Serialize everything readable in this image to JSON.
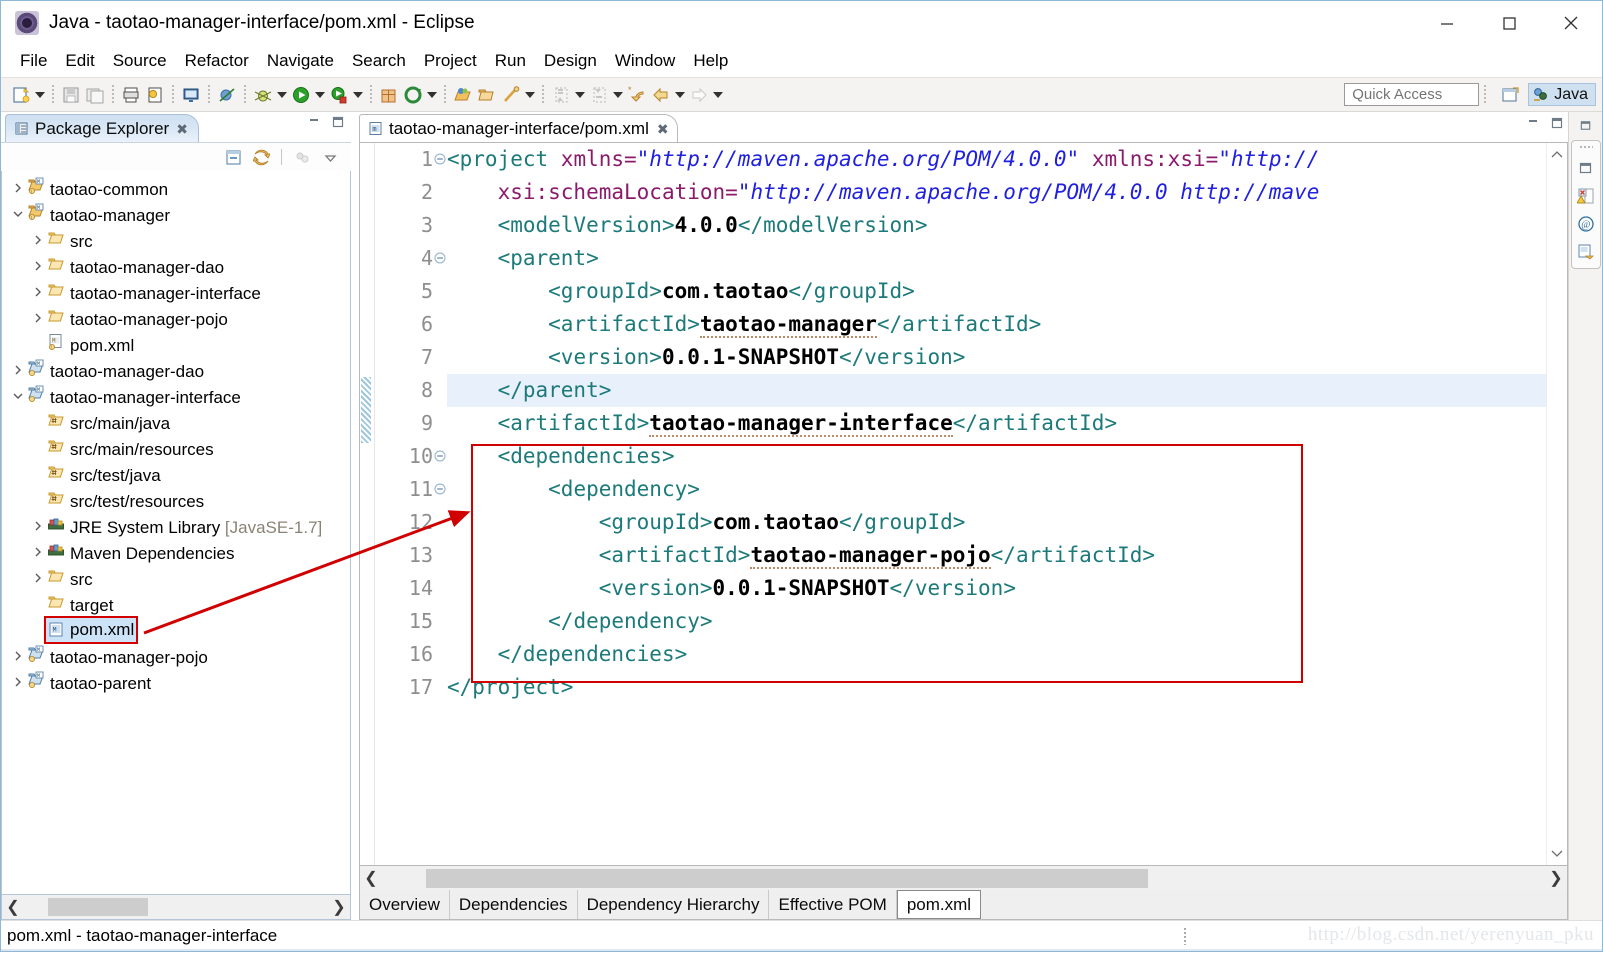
{
  "window": {
    "title": "Java - taotao-manager-interface/pom.xml - Eclipse",
    "app_icon": "eclipse-icon",
    "controls": {
      "minimize": "minimize-icon",
      "maximize": "maximize-icon",
      "close": "close-icon"
    }
  },
  "menubar": {
    "items": [
      "File",
      "Edit",
      "Source",
      "Refactor",
      "Navigate",
      "Search",
      "Project",
      "Run",
      "Design",
      "Window",
      "Help"
    ]
  },
  "toolbar": {
    "quick_access_placeholder": "Quick Access",
    "perspective_button": "open-perspective-icon",
    "perspective_current": "Java",
    "icons": [
      "new-wizard-icon",
      "dropdown-arrow",
      "save-icon",
      "save-all-icon",
      "print-icon",
      "annotation-icon",
      "open-console-icon",
      "skip-breakpoints-icon",
      "debug-icon",
      "dropdown-arrow",
      "run-icon",
      "dropdown-arrow",
      "run-last-tool-icon",
      "dropdown-arrow",
      "new-java-package-icon",
      "new-java-class-icon",
      "dropdown-arrow",
      "open-type-icon",
      "open-task-icon",
      "search-icon",
      "dropdown-arrow",
      "next-annotation-icon",
      "dropdown-arrow",
      "previous-annotation-icon",
      "dropdown-arrow",
      "last-edit-location-icon",
      "back-icon",
      "dropdown-arrow",
      "forward-icon",
      "dropdown-arrow"
    ]
  },
  "package_explorer": {
    "tab_label": "Package Explorer",
    "tab_icon": "package-explorer-icon",
    "close_icon": "close-tab-icon",
    "minimize_icon": "minimize-view-icon",
    "maximize_icon": "maximize-view-icon",
    "view_toolbar": [
      "collapse-all-icon",
      "link-with-editor-icon",
      "view-menu-icon",
      "view-chevron-icon"
    ],
    "tree": [
      {
        "label": "taotao-common",
        "indent": 0,
        "twisty": "collapsed",
        "icon": "maven-project-icon"
      },
      {
        "label": "taotao-manager",
        "indent": 0,
        "twisty": "expanded",
        "icon": "maven-project-icon"
      },
      {
        "label": "src",
        "indent": 1,
        "twisty": "collapsed",
        "icon": "folder-icon"
      },
      {
        "label": "taotao-manager-dao",
        "indent": 1,
        "twisty": "collapsed",
        "icon": "folder-icon"
      },
      {
        "label": "taotao-manager-interface",
        "indent": 1,
        "twisty": "collapsed",
        "icon": "folder-icon"
      },
      {
        "label": "taotao-manager-pojo",
        "indent": 1,
        "twisty": "collapsed",
        "icon": "folder-icon"
      },
      {
        "label": "pom.xml",
        "indent": 1,
        "twisty": "none",
        "icon": "maven-pom-icon"
      },
      {
        "label": "taotao-manager-dao",
        "indent": 0,
        "twisty": "collapsed",
        "icon": "java-project-icon"
      },
      {
        "label": "taotao-manager-interface",
        "indent": 0,
        "twisty": "expanded",
        "icon": "java-project-icon"
      },
      {
        "label": "src/main/java",
        "indent": 1,
        "twisty": "none",
        "icon": "source-folder-icon"
      },
      {
        "label": "src/main/resources",
        "indent": 1,
        "twisty": "none",
        "icon": "source-folder-icon"
      },
      {
        "label": "src/test/java",
        "indent": 1,
        "twisty": "none",
        "icon": "source-folder-icon"
      },
      {
        "label": "src/test/resources",
        "indent": 1,
        "twisty": "none",
        "icon": "source-folder-icon"
      },
      {
        "label": "JRE System Library",
        "suffix": "[JavaSE-1.7]",
        "indent": 1,
        "twisty": "collapsed",
        "icon": "library-icon"
      },
      {
        "label": "Maven Dependencies",
        "indent": 1,
        "twisty": "collapsed",
        "icon": "library-icon"
      },
      {
        "label": "src",
        "indent": 1,
        "twisty": "collapsed",
        "icon": "folder-icon"
      },
      {
        "label": "target",
        "indent": 1,
        "twisty": "none",
        "icon": "folder-icon"
      },
      {
        "label": "pom.xml",
        "indent": 1,
        "twisty": "none",
        "icon": "xml-file-icon",
        "selected": true,
        "highlighted": true
      },
      {
        "label": "taotao-manager-pojo",
        "indent": 0,
        "twisty": "collapsed",
        "icon": "java-project-icon"
      },
      {
        "label": "taotao-parent",
        "indent": 0,
        "twisty": "collapsed",
        "icon": "java-project-icon"
      }
    ],
    "hscroll": {
      "left_arrow": "scroll-left-icon",
      "right_arrow": "scroll-right-icon"
    }
  },
  "editor": {
    "tab_label": "taotao-manager-interface/pom.xml",
    "tab_icon": "maven-pom-icon",
    "close_icon": "close-tab-icon",
    "minimize_icon": "minimize-editor-icon",
    "maximize_icon": "maximize-editor-icon",
    "scroll_up_icon": "scroll-up-icon",
    "scroll_down_icon": "scroll-down-icon",
    "lines": [
      {
        "n": 1,
        "fold": "collapse",
        "indent": 0,
        "parts": [
          {
            "t": "tag",
            "v": "<project "
          },
          {
            "t": "attr",
            "v": "xmlns="
          },
          {
            "t": "str",
            "v": "\"http://maven.apache.org/POM/4.0.0\""
          },
          {
            "t": "plain",
            "v": " "
          },
          {
            "t": "attr",
            "v": "xmlns:xsi="
          },
          {
            "t": "str",
            "v": "\"http://"
          }
        ]
      },
      {
        "n": 2,
        "fold": "none",
        "indent": 1,
        "parts": [
          {
            "t": "attr",
            "v": "xsi:schemaLocation="
          },
          {
            "t": "str",
            "v": "\"http://maven.apache.org/POM/4.0.0 http://mave"
          }
        ]
      },
      {
        "n": 3,
        "fold": "none",
        "indent": 1,
        "parts": [
          {
            "t": "tag",
            "v": "<modelVersion>"
          },
          {
            "t": "txt",
            "v": "4.0.0"
          },
          {
            "t": "tag",
            "v": "</modelVersion>"
          }
        ]
      },
      {
        "n": 4,
        "fold": "collapse",
        "indent": 1,
        "parts": [
          {
            "t": "tag",
            "v": "<parent>"
          }
        ]
      },
      {
        "n": 5,
        "fold": "none",
        "indent": 2,
        "parts": [
          {
            "t": "tag",
            "v": "<groupId>"
          },
          {
            "t": "txt",
            "v": "com.taotao"
          },
          {
            "t": "tag",
            "v": "</groupId>"
          }
        ]
      },
      {
        "n": 6,
        "fold": "none",
        "indent": 2,
        "parts": [
          {
            "t": "tag",
            "v": "<artifactId>"
          },
          {
            "t": "txt sq",
            "v": "taotao-manager"
          },
          {
            "t": "tag",
            "v": "</artifactId>"
          }
        ]
      },
      {
        "n": 7,
        "fold": "none",
        "indent": 2,
        "parts": [
          {
            "t": "tag",
            "v": "<version>"
          },
          {
            "t": "txt",
            "v": "0.0.1-SNAPSHOT"
          },
          {
            "t": "tag",
            "v": "</version>"
          }
        ]
      },
      {
        "n": 8,
        "fold": "none",
        "indent": 1,
        "highlight": true,
        "parts": [
          {
            "t": "tag",
            "v": "</parent>"
          }
        ]
      },
      {
        "n": 9,
        "fold": "none",
        "indent": 1,
        "parts": [
          {
            "t": "tag",
            "v": "<artifactId>"
          },
          {
            "t": "txt sq",
            "v": "taotao-manager-interface"
          },
          {
            "t": "tag",
            "v": "</artifactId>"
          }
        ]
      },
      {
        "n": 10,
        "fold": "collapse",
        "indent": 1,
        "parts": [
          {
            "t": "tag",
            "v": "<dependencies>"
          }
        ]
      },
      {
        "n": 11,
        "fold": "collapse",
        "indent": 2,
        "parts": [
          {
            "t": "tag",
            "v": "<dependency>"
          }
        ]
      },
      {
        "n": 12,
        "fold": "none",
        "indent": 3,
        "parts": [
          {
            "t": "tag",
            "v": "<groupId>"
          },
          {
            "t": "txt",
            "v": "com.taotao"
          },
          {
            "t": "tag",
            "v": "</groupId>"
          }
        ]
      },
      {
        "n": 13,
        "fold": "none",
        "indent": 3,
        "parts": [
          {
            "t": "tag",
            "v": "<artifactId>"
          },
          {
            "t": "txt sq",
            "v": "taotao-manager-pojo"
          },
          {
            "t": "tag",
            "v": "</artifactId>"
          }
        ]
      },
      {
        "n": 14,
        "fold": "none",
        "indent": 3,
        "parts": [
          {
            "t": "tag",
            "v": "<version>"
          },
          {
            "t": "txt",
            "v": "0.0.1-SNAPSHOT"
          },
          {
            "t": "tag",
            "v": "</version>"
          }
        ]
      },
      {
        "n": 15,
        "fold": "none",
        "indent": 2,
        "parts": [
          {
            "t": "tag",
            "v": "</dependency>"
          }
        ]
      },
      {
        "n": 16,
        "fold": "none",
        "indent": 1,
        "parts": [
          {
            "t": "tag",
            "v": "</dependencies>"
          }
        ]
      },
      {
        "n": 17,
        "fold": "none",
        "indent": 0,
        "parts": [
          {
            "t": "tag",
            "v": "</project>"
          }
        ]
      }
    ],
    "hscroll": {
      "left_arrow": "scroll-left-icon",
      "right_arrow": "scroll-right-icon"
    },
    "form_tabs": [
      {
        "label": "Overview",
        "active": false
      },
      {
        "label": "Dependencies",
        "active": false
      },
      {
        "label": "Dependency Hierarchy",
        "active": false
      },
      {
        "label": "Effective POM",
        "active": false
      },
      {
        "label": "pom.xml",
        "active": true
      }
    ]
  },
  "right_bar": {
    "restore_icon": "restore-view-icon",
    "icons": [
      "problems-view-icon",
      "javadoc-view-icon",
      "declaration-view-icon"
    ]
  },
  "statusbar": {
    "text": "pom.xml - taotao-manager-interface",
    "watermark": "http://blog.csdn.net/yerenyuan_pku"
  },
  "annotations": {
    "highlight_color": "#d10000",
    "rect_label": "dependencies-block-highlight",
    "arrow_label": "pom-to-dependencies-arrow"
  }
}
